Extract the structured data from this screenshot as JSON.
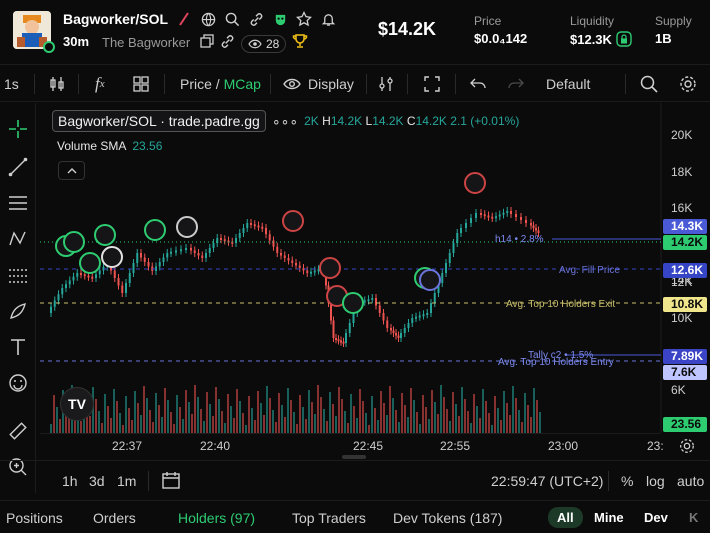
{
  "header": {
    "title": "Bagworker/SOL",
    "age": "30m",
    "creator": "The Bagworker",
    "watchers": "28",
    "price": "$14.2K",
    "stats": [
      {
        "label": "Price",
        "value": "$0.0₄142"
      },
      {
        "label": "Liquidity",
        "value": "$12.3K"
      },
      {
        "label": "Supply",
        "value": "1B"
      }
    ],
    "icons": [
      "flame-icon",
      "globe-icon",
      "search-icon",
      "link-icon",
      "mask-icon",
      "star-icon",
      "bell-icon"
    ]
  },
  "toolbar": {
    "interval": "1s",
    "price_label": "Price",
    "mcap_label": "MCap",
    "display_label": "Display",
    "layout_label": "Default"
  },
  "chart": {
    "symbol": "Bagworker/SOL · trade.padre.gg",
    "ohlc": {
      "o": "2K",
      "h": "14.2K",
      "l": "14.2K",
      "c": "14.2K",
      "change": "2.1 (+0.01%)"
    },
    "volume_label": "Volume SMA",
    "volume_value": "23.56",
    "y_ticks": [
      "20K",
      "18K",
      "16K",
      "14K",
      "12K",
      "10K",
      "7.6K",
      "6K"
    ],
    "tags": [
      {
        "label": "14.3K",
        "bg": "#4a5ad6",
        "fg": "#ffffff"
      },
      {
        "label": "14.2K",
        "bg": "#2ecc71",
        "fg": "#0b0b0c"
      },
      {
        "label": "12.6K",
        "bg": "#3545c5",
        "fg": "#ffffff"
      },
      {
        "label": "10.8K",
        "bg": "#f0e68c",
        "fg": "#0b0b0c"
      },
      {
        "label": "7.89K",
        "bg": "#3b44c7",
        "fg": "#ffffff"
      },
      {
        "label": "7.6K",
        "bg": "#bfc6ff",
        "fg": "#0b0b0c"
      },
      {
        "label": "23.56",
        "bg": "#2ecc71",
        "fg": "#0b0b0c"
      }
    ],
    "annotations": {
      "h14": "h14 • 2.8%",
      "avg_fill": "Avg. Fill Price",
      "top10_exit": "Avg. Top 10 Holders Exit",
      "tally": "Tally c2 • 1.5%",
      "top10_entry": "Avg. Top 10 Holders Entry"
    },
    "x_ticks": [
      "22:37",
      "22:40",
      "22:45",
      "22:55",
      "23:00",
      "23:"
    ]
  },
  "rangebar": {
    "ranges": [
      "1h",
      "3d",
      "1m"
    ],
    "clock": "22:59:47 (UTC+2)",
    "percent": "%",
    "log": "log",
    "auto": "auto"
  },
  "tabs": {
    "items": [
      "Positions",
      "Orders",
      "Holders (97)",
      "Top Traders",
      "Dev Tokens (187)"
    ],
    "filters": [
      "All",
      "Mine",
      "Dev",
      "K"
    ]
  }
}
